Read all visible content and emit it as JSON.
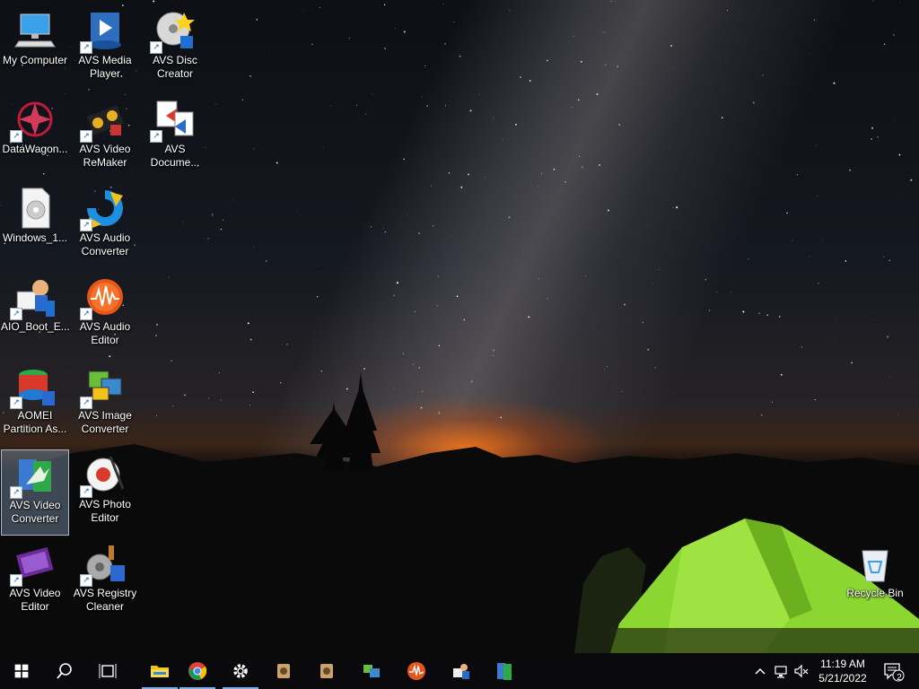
{
  "desktop": {
    "icons": [
      {
        "label": "My Computer",
        "icon": "computer-icon",
        "shortcut": false
      },
      {
        "label": "AVS Media\nPlayer",
        "icon": "media-player-icon",
        "shortcut": true
      },
      {
        "label": "AVS Disc\nCreator",
        "icon": "disc-creator-icon",
        "shortcut": true
      },
      {
        "label": "DataWagon...",
        "icon": "datawagon-icon",
        "shortcut": true
      },
      {
        "label": "AVS Video\nReMaker",
        "icon": "video-remaker-icon",
        "shortcut": true
      },
      {
        "label": "AVS\nDocume...",
        "icon": "document-converter-icon",
        "shortcut": true
      },
      {
        "label": "Windows_1...",
        "icon": "disc-image-file-icon",
        "shortcut": false
      },
      {
        "label": "AVS Audio\nConverter",
        "icon": "audio-converter-icon",
        "shortcut": true
      },
      {
        "label": "AIO_Boot_E...",
        "icon": "aio-boot-icon",
        "shortcut": true
      },
      {
        "label": "AVS Audio\nEditor",
        "icon": "audio-editor-icon",
        "shortcut": true
      },
      {
        "label": "AOMEI\nPartition As...",
        "icon": "aomei-partition-icon",
        "shortcut": true
      },
      {
        "label": "AVS Image\nConverter",
        "icon": "image-converter-icon",
        "shortcut": true
      },
      {
        "label": "AVS Video\nConverter",
        "icon": "video-converter-icon",
        "shortcut": true,
        "selected": true
      },
      {
        "label": "AVS Photo\nEditor",
        "icon": "photo-editor-icon",
        "shortcut": true
      },
      {
        "label": "AVS Video\nEditor",
        "icon": "video-editor-icon",
        "shortcut": true
      },
      {
        "label": "AVS Registry\nCleaner",
        "icon": "registry-cleaner-icon",
        "shortcut": true
      },
      {
        "label": "Recycle Bin",
        "icon": "recycle-bin-icon",
        "shortcut": false
      }
    ]
  },
  "taskbar": {
    "apps": [
      {
        "name": "start-button",
        "icon": "windows-logo-icon"
      },
      {
        "name": "search-button",
        "icon": "search-icon"
      },
      {
        "name": "task-view-button",
        "icon": "task-view-icon"
      },
      {
        "name": "file-explorer-button",
        "icon": "folder-icon",
        "active": true
      },
      {
        "name": "chrome-button",
        "icon": "chrome-icon",
        "active": true
      },
      {
        "name": "settings-button",
        "icon": "gear-icon",
        "active": true
      },
      {
        "name": "pinned-app-1-button",
        "icon": "app-icon"
      },
      {
        "name": "pinned-app-2-button",
        "icon": "app-icon"
      },
      {
        "name": "pinned-image-converter-button",
        "icon": "image-converter-icon"
      },
      {
        "name": "pinned-audio-editor-button",
        "icon": "audio-editor-icon"
      },
      {
        "name": "pinned-aio-boot-button",
        "icon": "aio-boot-icon"
      },
      {
        "name": "pinned-video-converter-button",
        "icon": "video-converter-icon"
      }
    ],
    "tray": {
      "chevron": "^",
      "time": "11:19 AM",
      "date": "5/21/2022",
      "notification_count": "2"
    }
  },
  "colors": {
    "taskbar": "#0a0a0c",
    "accent": "#7ab0e8",
    "tent": "#8bd630"
  }
}
